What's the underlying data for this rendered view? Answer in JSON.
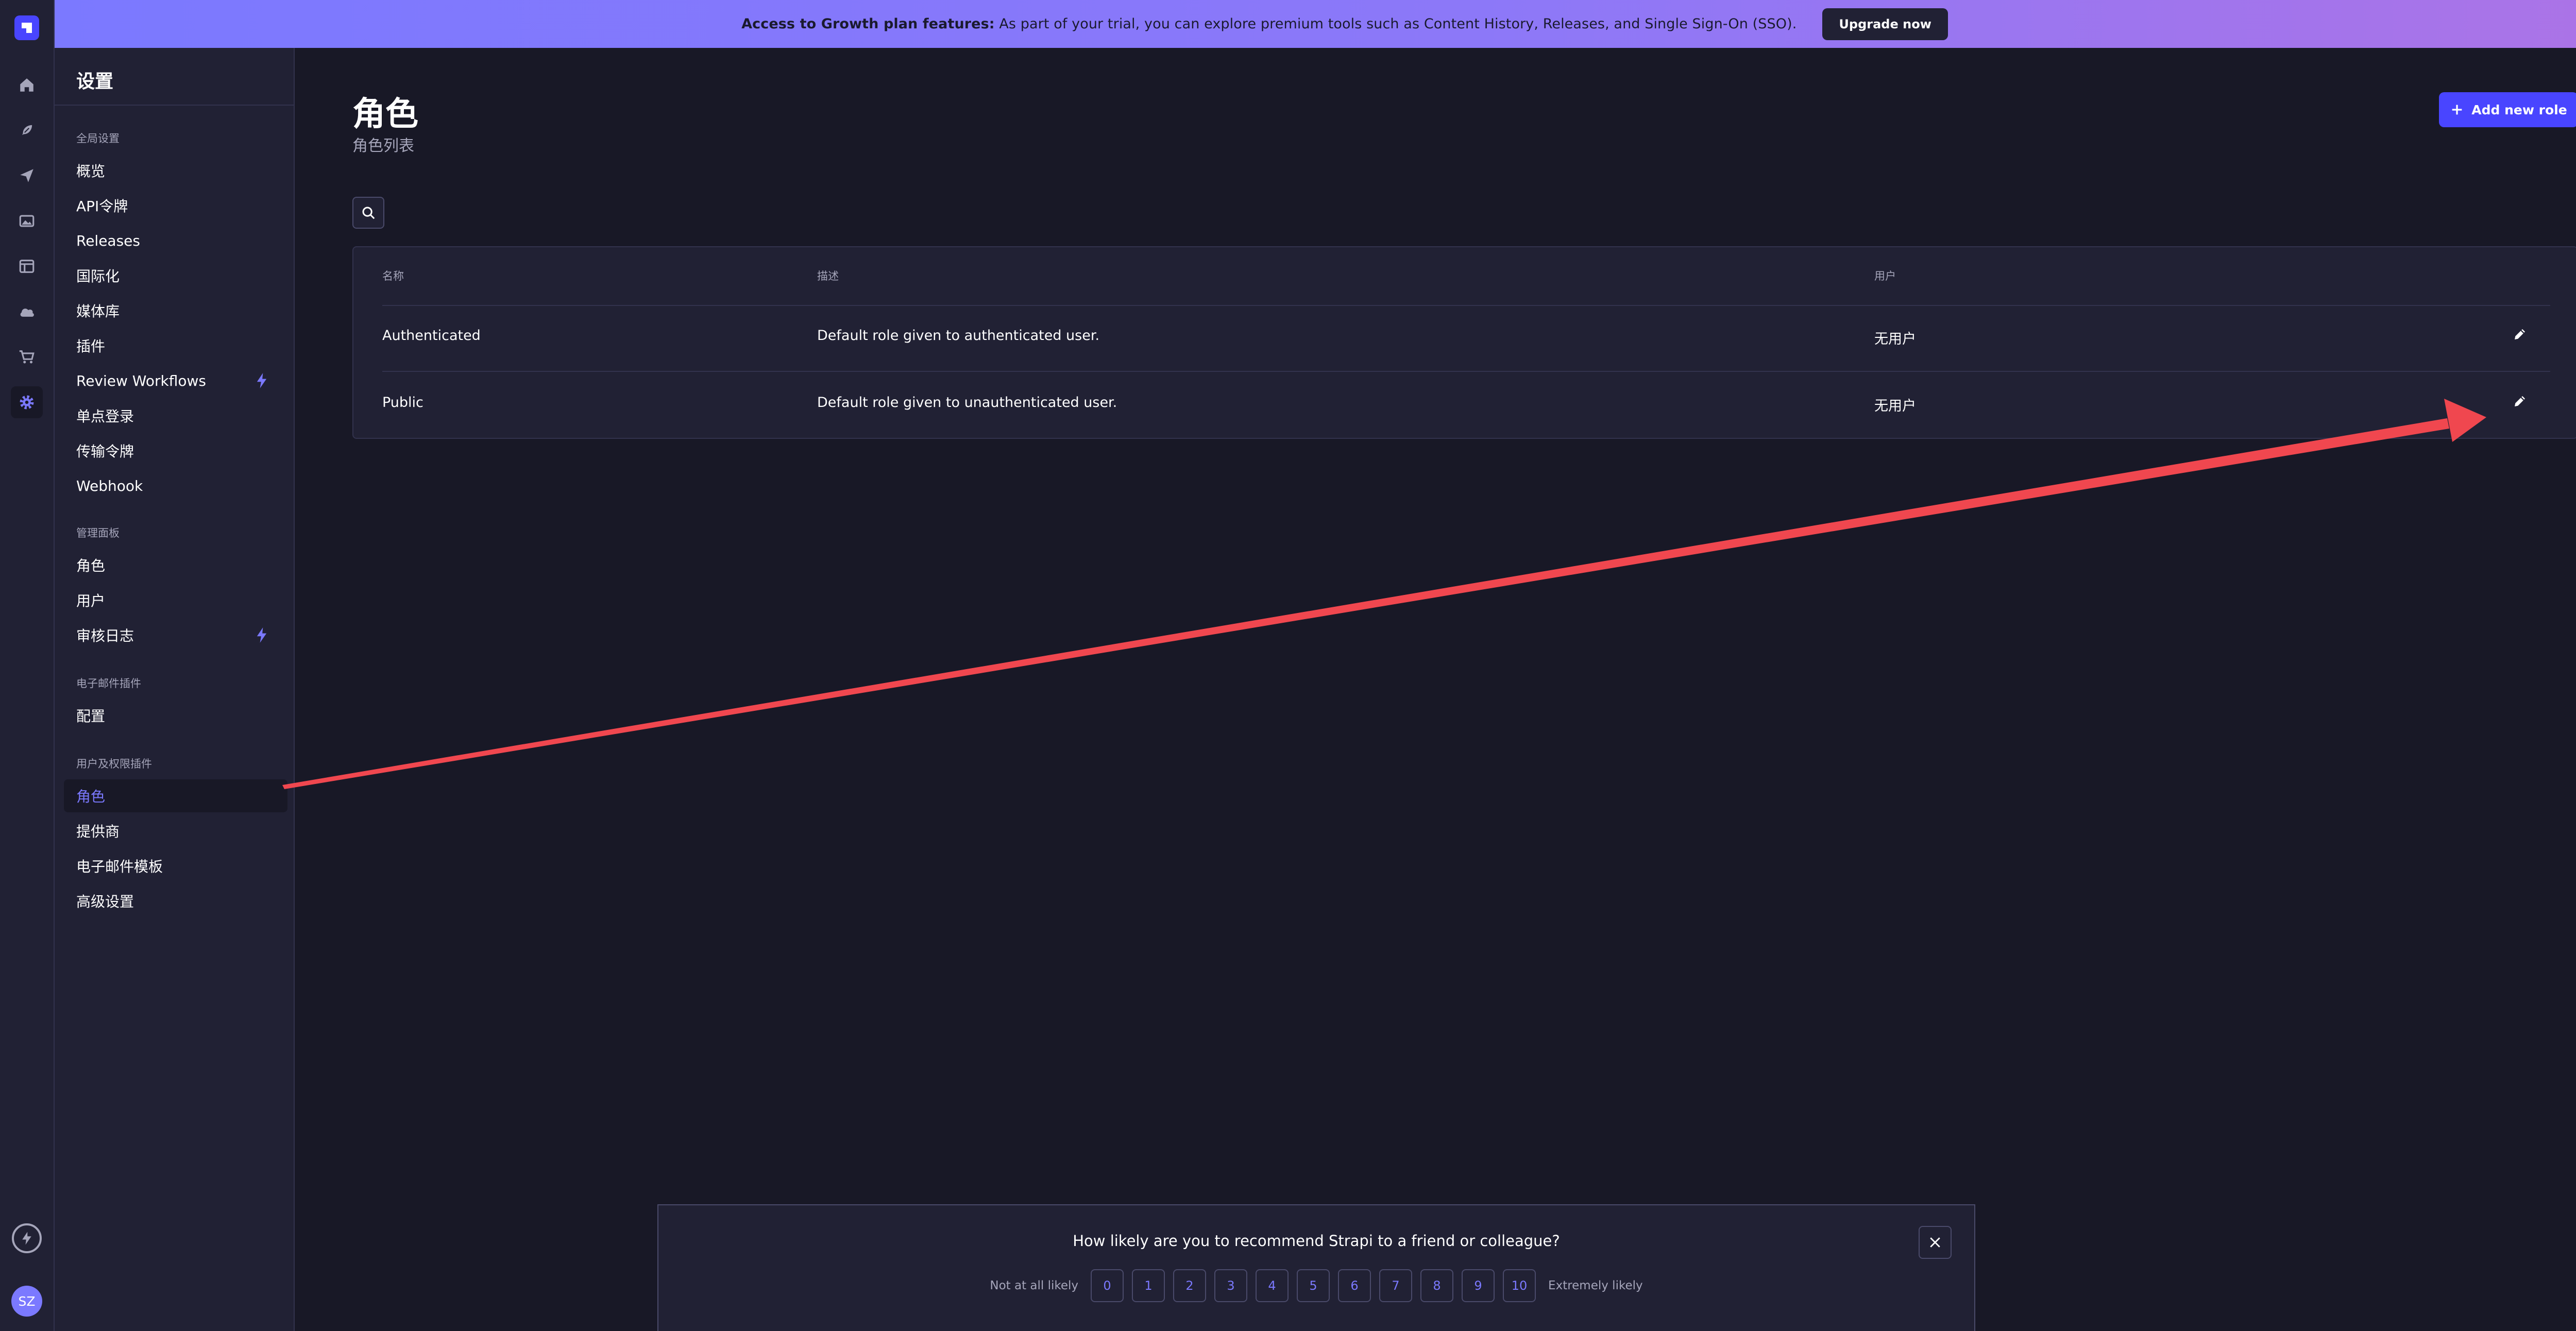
{
  "banner": {
    "bold_text": "Access to Growth plan features:",
    "text": " As part of your trial, you can explore premium tools such as Content History, Releases, and Single Sign-On (SSO).",
    "upgrade_label": "Upgrade now"
  },
  "rail": {
    "icons": [
      "home-icon",
      "feather-icon",
      "paper-plane-icon",
      "image-icon",
      "layout-icon",
      "cloud-icon",
      "cart-icon",
      "gear-icon"
    ],
    "avatar_initials": "SZ"
  },
  "sidebar": {
    "title": "设置",
    "sections": [
      {
        "label": "全局设置",
        "items": [
          "概览",
          "API令牌",
          "Releases",
          "国际化",
          "媒体库",
          "插件",
          "Review Workflows",
          "单点登录",
          "传输令牌",
          "Webhook"
        ]
      },
      {
        "label": "管理面板",
        "items": [
          "角色",
          "用户",
          "审核日志"
        ]
      },
      {
        "label": "电子邮件插件",
        "items": [
          "配置"
        ]
      },
      {
        "label": "用户及权限插件",
        "items": [
          "角色",
          "提供商",
          "电子邮件模板",
          "高级设置"
        ]
      }
    ],
    "active_item": "用户及权限插件 / 角色"
  },
  "main": {
    "title": "角色",
    "subtitle": "角色列表",
    "add_button_label": "Add new role",
    "table": {
      "headers": [
        "名称",
        "描述",
        "用户"
      ],
      "rows": [
        {
          "name": "Authenticated",
          "description": "Default role given to authenticated user.",
          "users": "无用户"
        },
        {
          "name": "Public",
          "description": "Default role given to unauthenticated user.",
          "users": "无用户"
        }
      ]
    }
  },
  "survey": {
    "question": "How likely are you to recommend Strapi to a friend or colleague?",
    "low_label": "Not at all likely",
    "high_label": "Extremely likely",
    "scale": [
      "0",
      "1",
      "2",
      "3",
      "4",
      "5",
      "6",
      "7",
      "8",
      "9",
      "10"
    ]
  },
  "colors": {
    "accent": "#4945ff",
    "accent_text": "#7b79ff",
    "background": "#181826",
    "panel": "#212134",
    "annotation_arrow": "#f0474f"
  }
}
